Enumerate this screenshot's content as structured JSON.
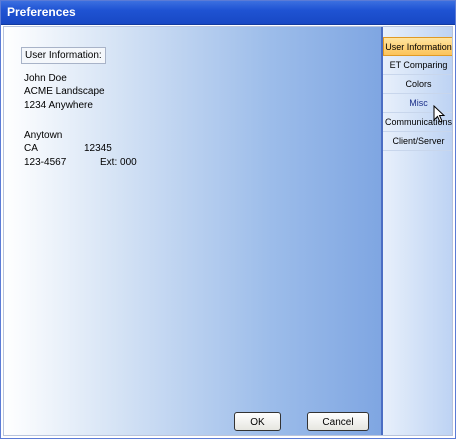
{
  "window": {
    "title": "Preferences"
  },
  "user_info": {
    "section_label": "User Information:",
    "name": "John Doe",
    "company": "ACME Landscape",
    "address": "1234 Anywhere",
    "city": "Anytown",
    "state": "CA",
    "zip": "12345",
    "phone": "123-4567",
    "ext": "Ext: 000"
  },
  "tabs": [
    {
      "label": "User Information",
      "state": "active"
    },
    {
      "label": "ET Comparing",
      "state": "normal"
    },
    {
      "label": "Colors",
      "state": "normal"
    },
    {
      "label": "Misc",
      "state": "hover"
    },
    {
      "label": "Communications",
      "state": "normal"
    },
    {
      "label": "Client/Server",
      "state": "normal"
    }
  ],
  "buttons": {
    "ok": "OK",
    "cancel": "Cancel"
  },
  "colors": {
    "titlebar": "#1f53d3",
    "active_tab": "#fcc35a"
  }
}
